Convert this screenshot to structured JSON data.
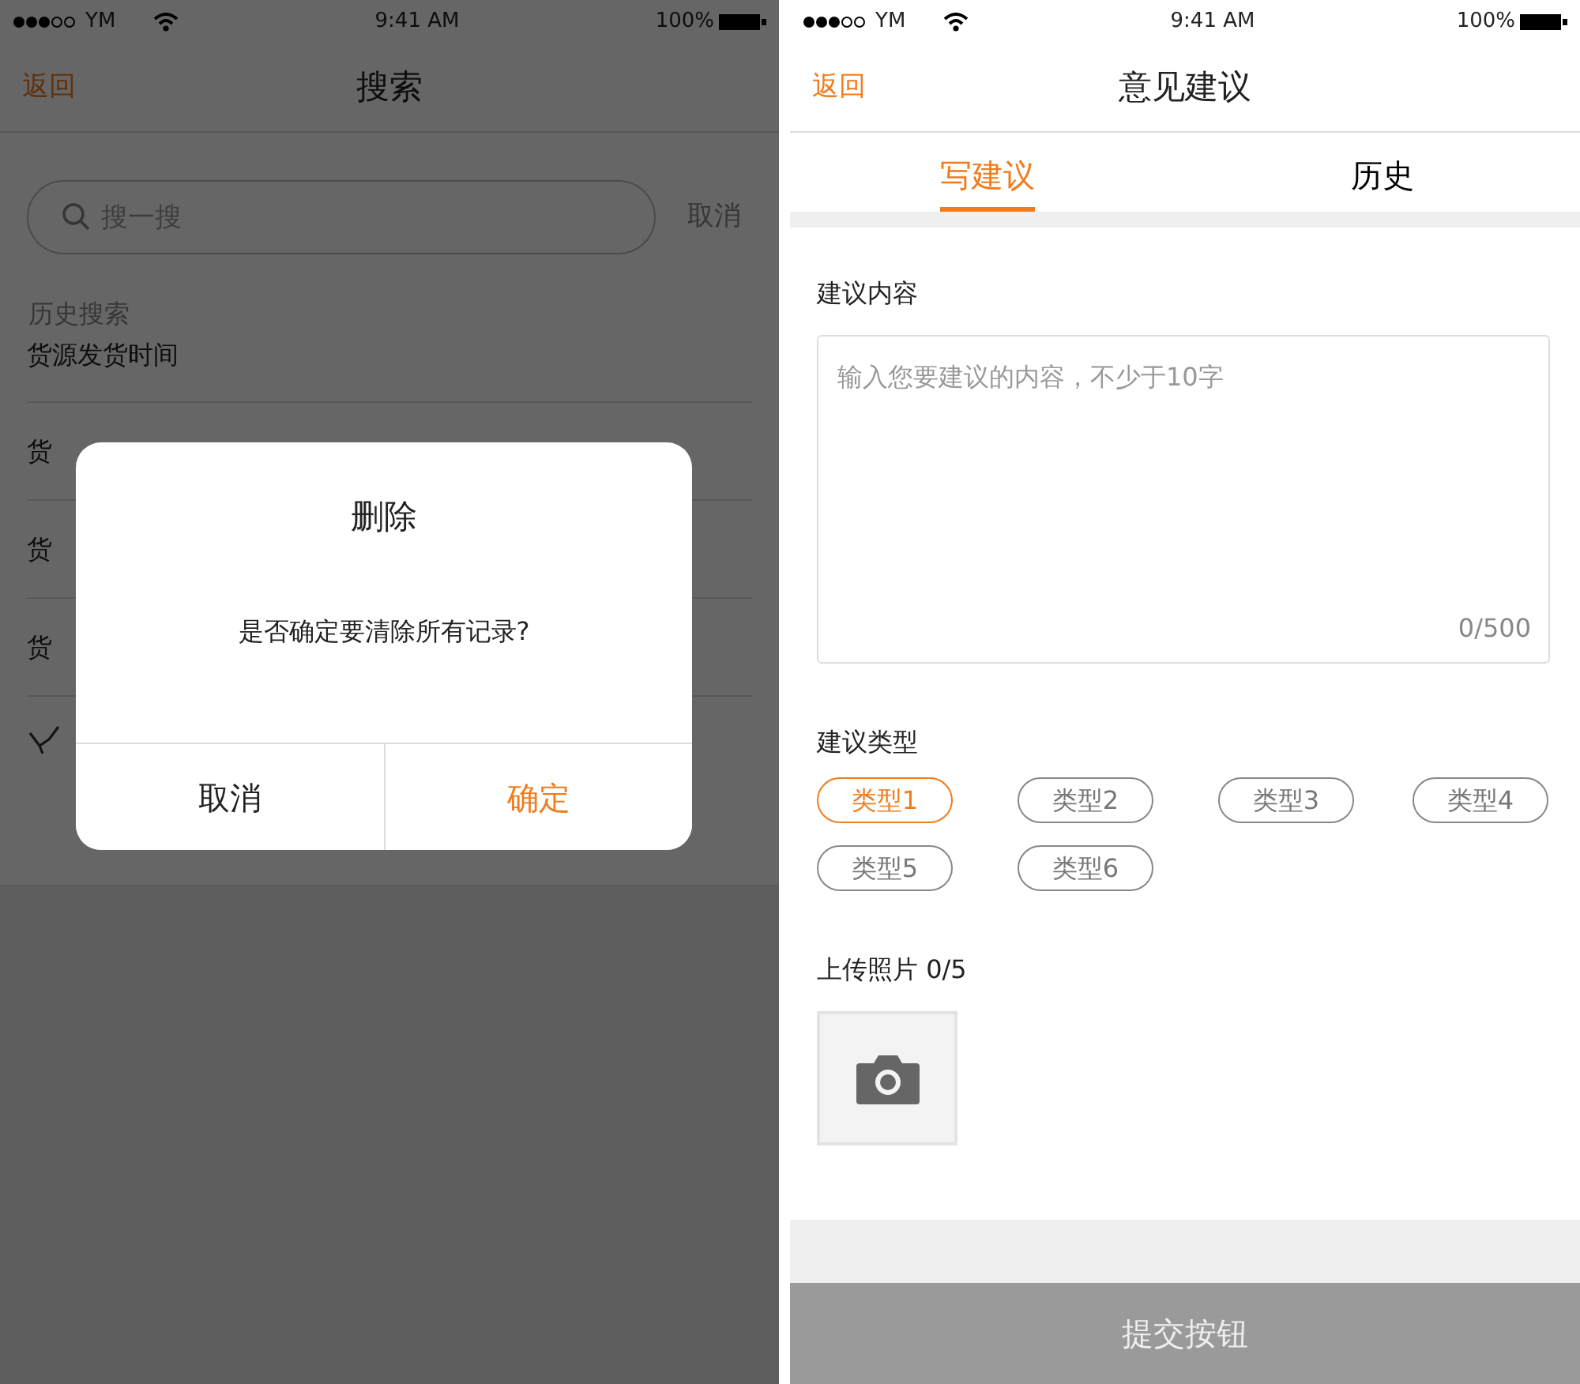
{
  "search_screen": {
    "status_bar": {
      "carrier": "YM",
      "time": "9:41 AM",
      "battery": "100%"
    },
    "nav": {
      "back": "返回",
      "title": "搜索"
    },
    "search": {
      "placeholder": "搜一搜",
      "cancel": "取消"
    },
    "history": {
      "heading": "历史搜索",
      "items": [
        "货源发货时间",
        "货",
        "货",
        "货"
      ]
    },
    "dialog": {
      "title": "删除",
      "message": "是否确定要清除所有记录?",
      "buttons": [
        {
          "label": "取消",
          "kind": "cancel"
        },
        {
          "label": "确定",
          "kind": "confirm"
        }
      ]
    }
  },
  "feedback_screen": {
    "status_bar": {
      "carrier": "YM",
      "time": "9:41 AM",
      "battery": "100%"
    },
    "nav": {
      "back": "返回",
      "title": "意见建议"
    },
    "tabs": [
      {
        "label": "写建议",
        "selected": true
      },
      {
        "label": "历史",
        "selected": false
      }
    ],
    "content": {
      "label": "建议内容",
      "placeholder": "输入您要建议的内容，不少于10字",
      "counter": "0/500"
    },
    "types": {
      "label": "建议类型",
      "options": [
        {
          "label": "类型1",
          "selected": true
        },
        {
          "label": "类型2",
          "selected": false
        },
        {
          "label": "类型3",
          "selected": false
        },
        {
          "label": "类型4",
          "selected": false
        },
        {
          "label": "类型5",
          "selected": false
        },
        {
          "label": "类型6",
          "selected": false
        }
      ]
    },
    "upload": {
      "label": "上传照片 0/5"
    },
    "submit": {
      "label": "提交按钮",
      "disabled": true
    }
  }
}
